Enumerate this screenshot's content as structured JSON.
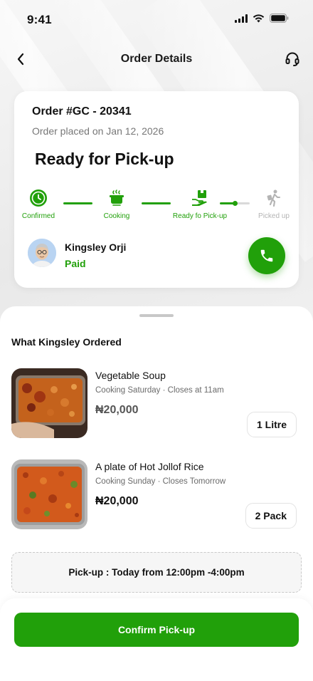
{
  "status_bar": {
    "time": "9:41"
  },
  "header": {
    "title": "Order Details",
    "back_icon": "chevron-left-icon",
    "support_icon": "headset-icon"
  },
  "order": {
    "number": "Order #GC - 20341",
    "placed_on": "Order placed on Jan 12, 2026",
    "status": "Ready for Pick-up",
    "steps": [
      {
        "label": "Confirmed",
        "icon": "clock-icon",
        "state": "done"
      },
      {
        "label": "Cooking",
        "icon": "cooking-pot-icon",
        "state": "done"
      },
      {
        "label": "Ready fo Pick-up",
        "icon": "hand-package-icon",
        "state": "done"
      },
      {
        "label": "Picked up",
        "icon": "walking-person-icon",
        "state": "pending"
      }
    ],
    "customer": {
      "name": "Kingsley Orji",
      "payment": "Paid"
    }
  },
  "items_section": {
    "title": "What Kingsley Ordered",
    "items": [
      {
        "name": "Vegetable Soup",
        "meta": "Cooking Saturday · Closes at 11am",
        "price": "₦20,000",
        "quantity": "1 Litre"
      },
      {
        "name": "A plate of Hot Jollof Rice",
        "meta": "Cooking Sunday · Closes Tomorrow",
        "price": "₦20,000",
        "quantity": "2 Pack"
      }
    ]
  },
  "pickup": {
    "text": "Pick-up : Today from 12:00pm -4:00pm"
  },
  "footer": {
    "confirm_label": "Confirm Pick-up"
  },
  "colors": {
    "accent": "#21a00a",
    "muted": "#b4b4b4",
    "background": "#ececec"
  }
}
